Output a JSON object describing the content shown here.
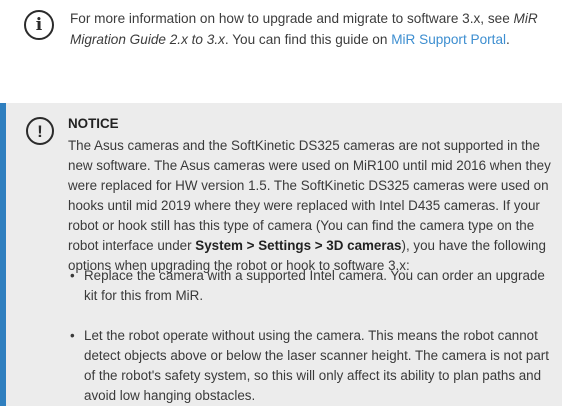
{
  "info": {
    "icon": "info-circle-icon",
    "text_1": "For more information on how to upgrade and migrate to software 3.x, see ",
    "guide_title": "MiR Migration Guide 2.x to 3.x",
    "text_2": ". You can find this guide on ",
    "portal_link": "MiR Support Portal",
    "text_3": "."
  },
  "notice": {
    "icon": "exclamation-circle-icon",
    "accent_color": "#2f7fbf",
    "title": "NOTICE",
    "body_1": "The Asus cameras and the SoftKinetic DS325 cameras are not supported in the new software. The Asus cameras were used on MiR100 until mid 2016 when they were replaced for HW version 1.5. The SoftKinetic DS325 cameras were used on hooks until mid 2019 where they were replaced with Intel D435 cameras. If your robot or hook still has this type of camera (You can find the camera type on the robot interface under ",
    "menu_path": "System > Settings > 3D cameras",
    "body_2": "), you have the following options when upgrading the robot or hook to software 3.x:",
    "options": [
      "Replace the camera with a supported Intel camera. You can order an upgrade kit for this from MiR.",
      "Let the robot operate without using the camera. This means the robot cannot detect objects above or below the laser scanner height. The camera is not part of the robot's safety system, so this will only affect its ability to plan paths and avoid low hanging obstacles."
    ],
    "bullet": "•"
  }
}
